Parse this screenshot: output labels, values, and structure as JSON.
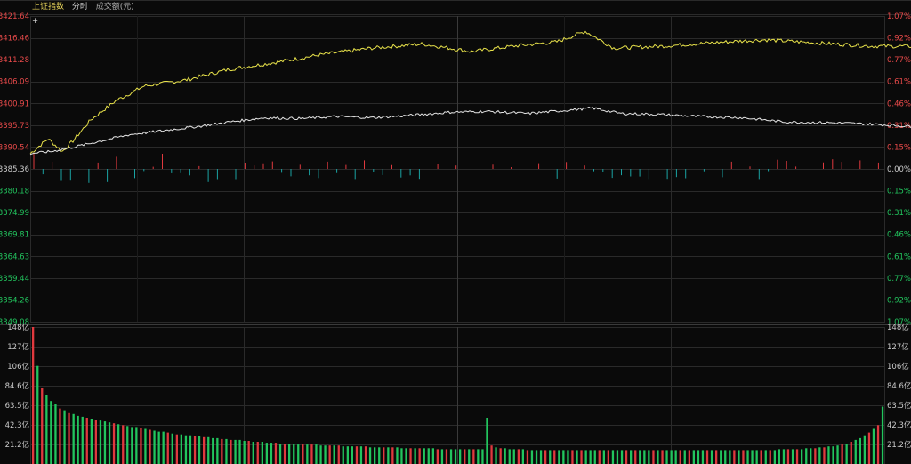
{
  "header": {
    "index_name": "上证指数",
    "mode_tab": "分时",
    "volume_tab": "成交额(元)",
    "crosshair_icon": "crosshair-icon"
  },
  "colors": {
    "background": "#0a0a0a",
    "grid": "#2a2a2a",
    "price_line": "#e8e24a",
    "avg_line": "#e6e6e6",
    "up": "#e0393e",
    "down": "#1aa3a3",
    "up_text": "#e84a4a",
    "down_text": "#22c55e",
    "flat_text": "#cccccc"
  },
  "chart_data": [
    {
      "type": "line",
      "title": "",
      "ylim": [
        3349.08,
        3421.64
      ],
      "prev_close": 3385.36,
      "left_ticks": [
        "3421.64",
        "3416.46",
        "3411.28",
        "3406.09",
        "3400.91",
        "3395.73",
        "3390.54",
        "3385.36",
        "3380.18",
        "3374.99",
        "3369.81",
        "3364.63",
        "3359.44",
        "3354.26",
        "3349.08"
      ],
      "right_ticks": [
        "1.07%",
        "0.92%",
        "0.77%",
        "0.61%",
        "0.46%",
        "0.31%",
        "0.15%",
        "0.00%",
        "0.15%",
        "0.31%",
        "0.46%",
        "0.61%",
        "0.77%",
        "0.92%",
        "1.07%"
      ],
      "series": [
        {
          "name": "",
          "points": [
            [
              0,
              3389.0
            ],
            [
              5,
              3392.5
            ],
            [
              9,
              3389.5
            ],
            [
              12,
              3392.0
            ],
            [
              17,
              3397.0
            ],
            [
              24,
              3401.5
            ],
            [
              32,
              3405.0
            ],
            [
              44,
              3406.5
            ],
            [
              56,
              3409.0
            ],
            [
              68,
              3410.5
            ],
            [
              82,
              3412.5
            ],
            [
              96,
              3414.0
            ],
            [
              110,
              3415.0
            ],
            [
              124,
              3413.2
            ],
            [
              136,
              3414.5
            ],
            [
              148,
              3415.5
            ],
            [
              156,
              3418.0
            ],
            [
              164,
              3414.0
            ],
            [
              178,
              3414.5
            ],
            [
              190,
              3415.2
            ],
            [
              206,
              3416.0
            ],
            [
              222,
              3415.2
            ],
            [
              236,
              3414.5
            ],
            [
              256,
              3414.4
            ],
            [
              270,
              3413.5
            ],
            [
              288,
              3414.0
            ],
            [
              306,
              3414.2
            ],
            [
              322,
              3413.2
            ],
            [
              340,
              3413.0
            ],
            [
              358,
              3413.5
            ],
            [
              376,
              3413.4
            ],
            [
              394,
              3412.8
            ],
            [
              412,
              3414.0
            ],
            [
              424,
              3415.0
            ],
            [
              436,
              3416.2
            ],
            [
              448,
              3417.0
            ],
            [
              460,
              3417.5
            ],
            [
              472,
              3418.5
            ],
            [
              484,
              3418.5
            ],
            [
              494,
              3418.0
            ],
            [
              504,
              3418.3
            ],
            [
              514,
              3418.8
            ],
            [
              526,
              3418.5
            ],
            [
              536,
              3418.0
            ],
            [
              546,
              3418.4
            ],
            [
              556,
              3419.0
            ],
            [
              566,
              3419.5
            ],
            [
              576,
              3419.8
            ],
            [
              586,
              3420.5
            ],
            [
              596,
              3420.2
            ],
            [
              606,
              3420.0
            ],
            [
              612,
              3421.0
            ],
            [
              618,
              3421.2
            ]
          ]
        },
        {
          "name": "",
          "points": [
            [
              0,
              3389.0
            ],
            [
              6,
              3389.5
            ],
            [
              12,
              3390.5
            ],
            [
              20,
              3392.0
            ],
            [
              28,
              3393.5
            ],
            [
              38,
              3394.5
            ],
            [
              48,
              3395.5
            ],
            [
              56,
              3396.5
            ],
            [
              66,
              3397.5
            ],
            [
              76,
              3397.3
            ],
            [
              86,
              3397.8
            ],
            [
              96,
              3397.5
            ],
            [
              106,
              3398.0
            ],
            [
              118,
              3398.8
            ],
            [
              128,
              3399.0
            ],
            [
              140,
              3398.5
            ],
            [
              150,
              3399.2
            ],
            [
              158,
              3399.8
            ],
            [
              166,
              3398.5
            ],
            [
              176,
              3398.3
            ],
            [
              188,
              3397.8
            ],
            [
              200,
              3397.5
            ],
            [
              212,
              3396.5
            ],
            [
              226,
              3396.3
            ],
            [
              236,
              3396.0
            ],
            [
              246,
              3395.5
            ],
            [
              256,
              3395.0
            ],
            [
              270,
              3394.5
            ],
            [
              282,
              3395.2
            ],
            [
              296,
              3395.8
            ],
            [
              306,
              3396.0
            ],
            [
              318,
              3395.8
            ],
            [
              332,
              3395.5
            ],
            [
              346,
              3395.7
            ],
            [
              360,
              3395.5
            ],
            [
              372,
              3395.0
            ],
            [
              386,
              3395.5
            ],
            [
              398,
              3396.0
            ],
            [
              412,
              3396.4
            ],
            [
              426,
              3396.5
            ],
            [
              440,
              3396.8
            ],
            [
              454,
              3397.0
            ],
            [
              468,
              3397.3
            ],
            [
              482,
              3397.2
            ],
            [
              494,
              3397.0
            ],
            [
              506,
              3397.3
            ],
            [
              518,
              3397.5
            ],
            [
              530,
              3397.2
            ],
            [
              542,
              3397.5
            ],
            [
              556,
              3397.8
            ],
            [
              568,
              3398.0
            ],
            [
              580,
              3398.5
            ],
            [
              592,
              3399.2
            ],
            [
              602,
              3400.0
            ],
            [
              612,
              3400.4
            ],
            [
              618,
              3400.5
            ]
          ]
        }
      ]
    },
    {
      "type": "bar",
      "title": "",
      "ylim": [
        0,
        148
      ],
      "left_ticks": [
        "148亿",
        "127亿",
        "106亿",
        "84.6亿",
        "63.5亿",
        "42.3亿",
        "21.2亿"
      ],
      "right_ticks": [
        "148亿",
        "127亿",
        "106亿",
        "84.6亿",
        "63.5亿",
        "42.3亿",
        "21.2亿"
      ],
      "values": [
        148,
        106,
        82,
        75,
        68,
        65,
        60,
        58,
        55,
        54,
        52,
        51,
        50,
        49,
        48,
        47,
        46,
        45,
        44,
        43,
        42,
        41,
        40,
        40,
        39,
        38,
        37,
        36,
        35,
        35,
        34,
        33,
        32,
        32,
        31,
        31,
        30,
        30,
        29,
        29,
        28,
        28,
        27,
        27,
        26,
        26,
        26,
        25,
        25,
        24,
        24,
        24,
        23,
        23,
        23,
        22,
        22,
        22,
        22,
        21,
        21,
        21,
        21,
        21,
        20,
        20,
        20,
        20,
        20,
        19,
        19,
        19,
        19,
        19,
        19,
        18,
        18,
        18,
        18,
        18,
        18,
        18,
        17,
        17,
        17,
        17,
        17,
        17,
        17,
        17,
        16,
        16,
        16,
        16,
        16,
        16,
        16,
        16,
        16,
        16,
        16,
        50,
        20,
        18,
        17,
        17,
        16,
        16,
        16,
        16,
        15,
        15,
        15,
        15,
        15,
        15,
        15,
        15,
        15,
        15,
        15,
        15,
        15,
        15,
        15,
        15,
        15,
        15,
        15,
        15,
        15,
        15,
        15,
        15,
        15,
        15,
        15,
        15,
        15,
        15,
        15,
        15,
        15,
        15,
        15,
        15,
        15,
        15,
        15,
        15,
        15,
        15,
        15,
        15,
        15,
        15,
        15,
        15,
        15,
        15,
        15,
        15,
        15,
        15,
        15,
        15,
        16,
        16,
        16,
        16,
        16,
        16,
        17,
        17,
        17,
        18,
        18,
        19,
        19,
        20,
        21,
        22,
        24,
        26,
        28,
        31,
        34,
        38,
        42,
        62
      ]
    }
  ]
}
